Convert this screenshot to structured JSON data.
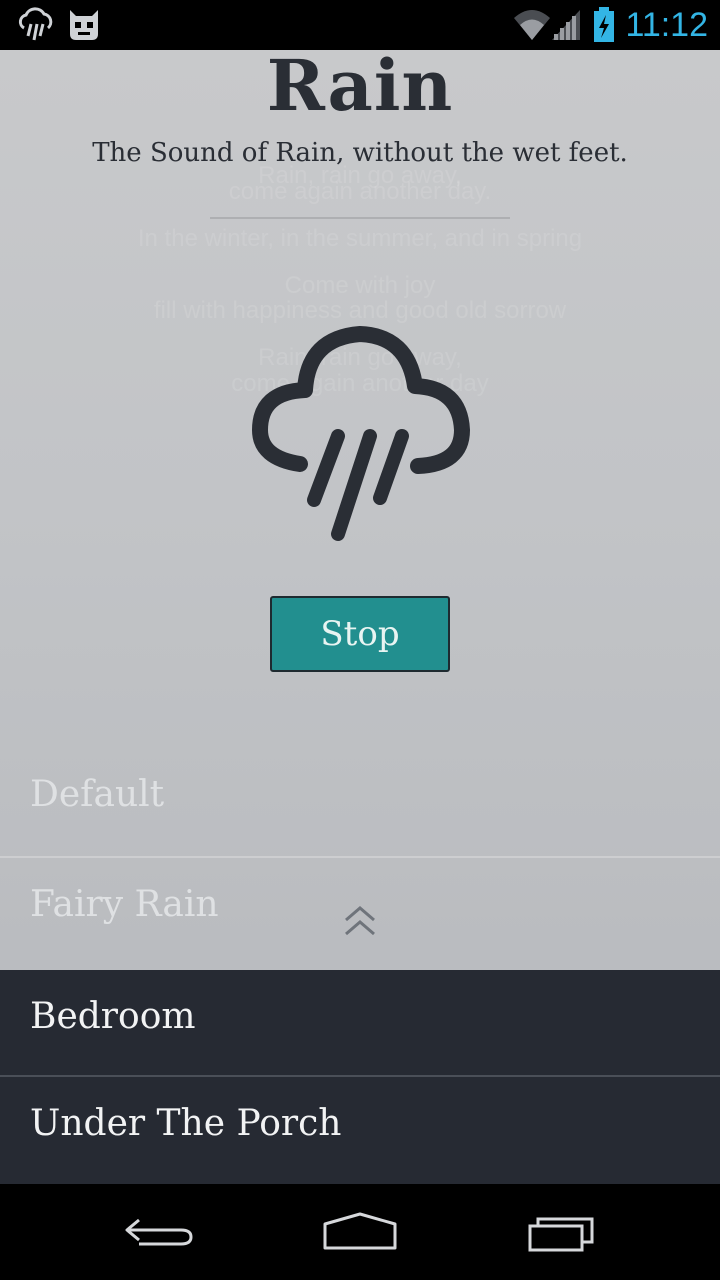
{
  "status_bar": {
    "time": "11:12",
    "icons": [
      "rain-notification-icon",
      "cyanogenmod-icon",
      "wifi-icon",
      "signal-icon",
      "battery-charging-icon"
    ]
  },
  "app": {
    "title": "Rain",
    "subtitle": "The Sound of Rain, without the wet feet.",
    "lyrics": [
      "Rain, rain go away,",
      "come again another day.",
      "In the winter, in the summer, and in spring",
      "Come with joy",
      "fill with happiness and good old sorrow",
      "Rain, rain go away,",
      "come again another day"
    ],
    "main_icon": "cloud-rain-icon",
    "stop_label": "Stop"
  },
  "sound_list": {
    "items": [
      "Default",
      "Fairy Rain",
      "Bedroom",
      "Under The Porch"
    ],
    "expand_icon": "double-chevron-up-icon"
  },
  "nav_bar": {
    "icons": [
      "back-icon",
      "home-icon",
      "recent-apps-icon"
    ]
  },
  "colors": {
    "accent": "#228f8f",
    "dark_panel": "#262a33",
    "clock": "#33b5e5"
  }
}
